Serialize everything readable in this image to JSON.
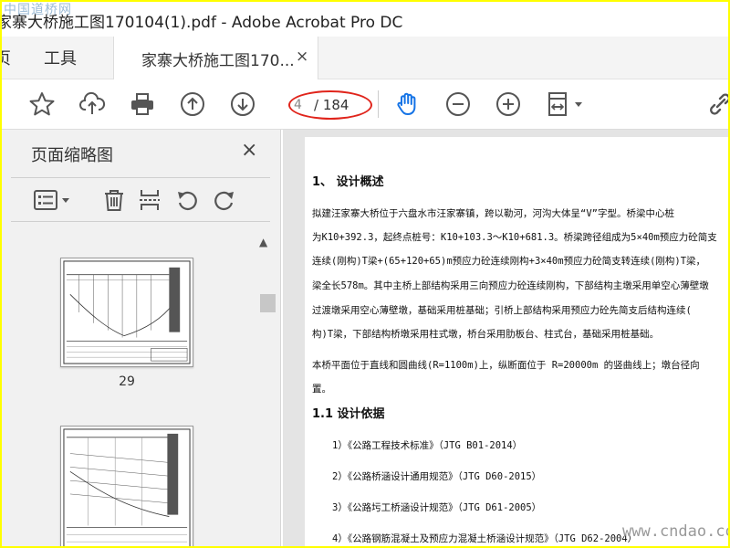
{
  "window": {
    "title": "家寨大桥施工图170104(1).pdf - Adobe Acrobat Pro DC",
    "watermark_top": "中国道桥网"
  },
  "tabs": {
    "home_label": "页",
    "tools_label": "工具",
    "doc_label": "家寨大桥施工图170...",
    "doc_close": "×"
  },
  "toolbar": {
    "page_current": "4",
    "page_total": "/ 184",
    "icons": [
      "star-icon",
      "upload-icon",
      "print-icon",
      "page-up-icon",
      "page-down-icon",
      "hand-icon",
      "zoom-out-icon",
      "zoom-in-icon",
      "fit-page-icon",
      "link-icon"
    ],
    "accent_color": "#1473e6",
    "highlight_color": "#e0241b"
  },
  "sidebar": {
    "title": "页面缩略图",
    "close": "×",
    "tools": [
      "thumbnail-options-icon",
      "delete-icon",
      "insert-page-icon",
      "rotate-left-icon",
      "rotate-right-icon"
    ],
    "thumbnails": [
      {
        "label": "29"
      },
      {
        "label": ""
      }
    ]
  },
  "document": {
    "heading1": "1、   设计概述",
    "para1": [
      "   拟建汪家寨大桥位于六盘水市汪家寨镇，跨以勒河，河沟大体呈“V”字型。桥梁中心桩",
      "为K10+392.3，起终点桩号：K10+103.3～K10+681.3。桥梁跨径组成为5×40m预应力砼简支",
      "连续(刚构)T梁+(65+120+65)m预应力砼连续刚构+3×40m预应力砼简支转连续(刚构)T梁，",
      "梁全长578m。其中主桥上部结构采用三向预应力砼连续刚构，下部结构主墩采用单空心薄壁墩",
      "过渡墩采用空心薄壁墩，基础采用桩基础；引桥上部结构采用预应力砼先简支后结构连续(",
      "构)T梁，下部结构桥墩采用柱式墩，桥台采用肋板台、柱式台，基础采用桩基础。"
    ],
    "para2": [
      "   本桥平面位于直线和圆曲线(R=1100m)上，纵断面位于 R=20000m 的竖曲线上；墩台径向",
      "置。"
    ],
    "heading2": "1.1 设计依据",
    "refs": [
      "1）《公路工程技术标准》（JTG B01-2014）",
      "2）《公路桥涵设计通用规范》（JTG D60-2015）",
      "3）《公路圬工桥涵设计规范》（JTG D61-2005）",
      "4）《公路钢筋混凝土及预应力混凝土桥涵设计规范》（JTG D62-2004）"
    ]
  },
  "watermark_bottom": "www.cndao.com"
}
